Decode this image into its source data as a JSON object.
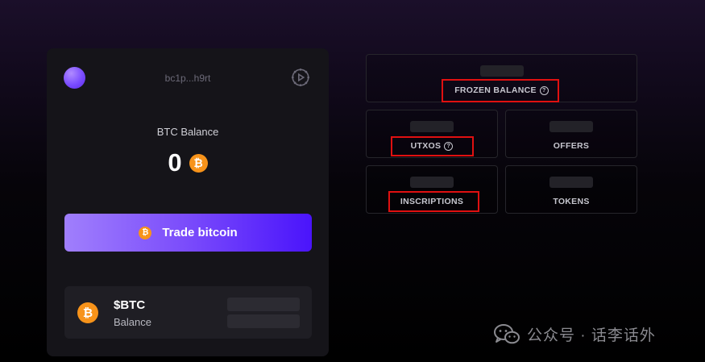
{
  "wallet": {
    "address": "bc1p...h9rt",
    "balance_label": "BTC Balance",
    "balance_value": "0",
    "btc_symbol": "₿",
    "trade_button_label": "Trade bitcoin",
    "token": {
      "name": "$BTC",
      "subtitle": "Balance"
    }
  },
  "stats": {
    "frozen_balance": "FROZEN BALANCE",
    "utxos": "UTXOS",
    "offers": "OFFERS",
    "inscriptions": "INSCRIPTIONS",
    "tokens": "TOKENS",
    "help_glyph": "?"
  },
  "watermark": {
    "text": "公众号 · 话李话外"
  },
  "colors": {
    "accent_gradient_start": "#a07ffc",
    "accent_gradient_end": "#4a14fb",
    "bitcoin_orange": "#f7931a",
    "highlight_red": "#e01010"
  }
}
